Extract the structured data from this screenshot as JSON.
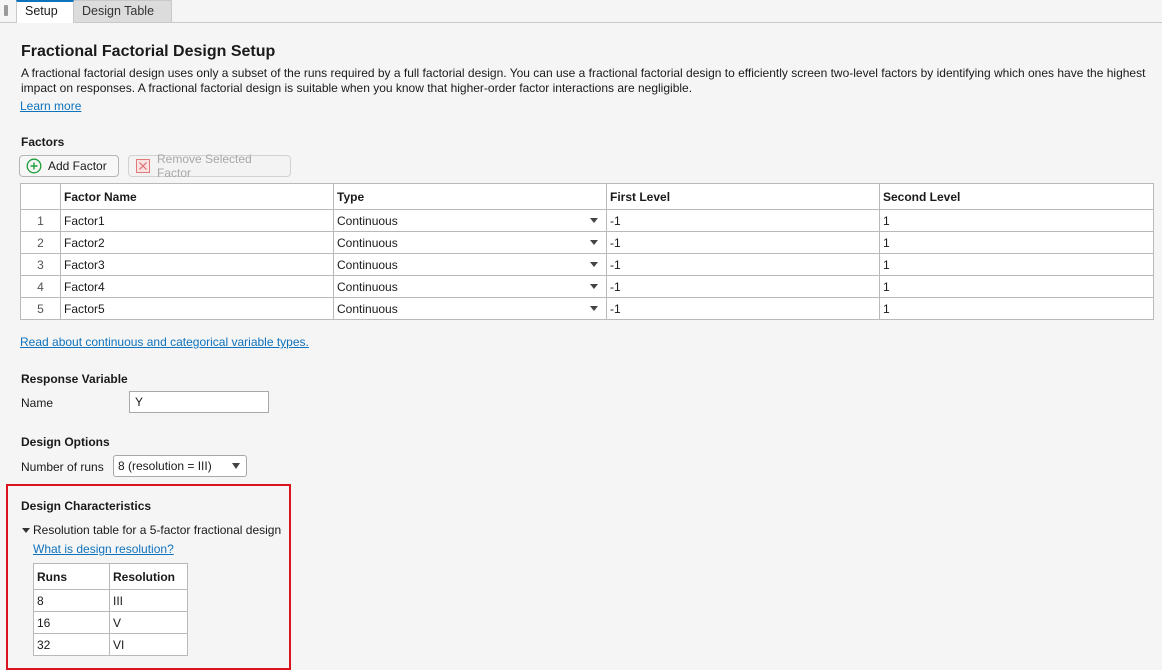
{
  "tabs": [
    {
      "label": "Setup",
      "active": true
    },
    {
      "label": "Design Table",
      "active": false
    }
  ],
  "header": {
    "title": "Fractional Factorial Design Setup",
    "description": "A fractional factorial design uses only a subset of the runs required by a full factorial design. You can use a fractional factorial design to efficiently screen two-level factors by identifying which ones have the highest impact on responses. A fractional factorial design is suitable when you know that higher-order factor interactions are negligible.",
    "learn_more": "Learn more"
  },
  "factors": {
    "section_title": "Factors",
    "add_button": "Add Factor",
    "remove_button": "Remove Selected Factor",
    "columns": [
      "",
      "Factor Name",
      "Type",
      "First Level",
      "Second Level"
    ],
    "rows": [
      {
        "num": "1",
        "name": "Factor1",
        "type": "Continuous",
        "first": "-1",
        "second": "1"
      },
      {
        "num": "2",
        "name": "Factor2",
        "type": "Continuous",
        "first": "-1",
        "second": "1"
      },
      {
        "num": "3",
        "name": "Factor3",
        "type": "Continuous",
        "first": "-1",
        "second": "1"
      },
      {
        "num": "4",
        "name": "Factor4",
        "type": "Continuous",
        "first": "-1",
        "second": "1"
      },
      {
        "num": "5",
        "name": "Factor5",
        "type": "Continuous",
        "first": "-1",
        "second": "1"
      }
    ],
    "types_link": "Read about continuous and categorical variable types."
  },
  "response": {
    "section_title": "Response Variable",
    "name_label": "Name",
    "name_value": "Y"
  },
  "options": {
    "section_title": "Design Options",
    "runs_label": "Number of runs",
    "runs_value": "8 (resolution = III)"
  },
  "characteristics": {
    "section_title": "Design Characteristics",
    "tree_label": "Resolution table for a 5-factor fractional design",
    "resolution_link": "What is design resolution?",
    "columns": [
      "Runs",
      "Resolution"
    ],
    "rows": [
      {
        "runs": "8",
        "resolution": "III"
      },
      {
        "runs": "16",
        "resolution": "V"
      },
      {
        "runs": "32",
        "resolution": "VI"
      }
    ]
  },
  "colors": {
    "accent": "#0e72bd",
    "highlight_border": "#d9141c",
    "add_icon": "#1f9d3a",
    "remove_icon": "#e07a7a"
  },
  "icons": {
    "add": "plus-circle-icon",
    "remove": "x-square-icon",
    "expand": "triangle-down-icon"
  }
}
